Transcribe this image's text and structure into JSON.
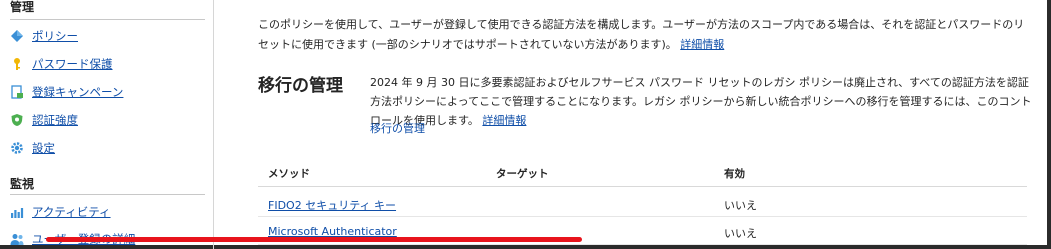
{
  "sidebar": {
    "manage_heading": "管理",
    "manage_items": [
      {
        "label": "ポリシー",
        "icon": "diamond-icon"
      },
      {
        "label": "パスワード保護",
        "icon": "key-icon"
      },
      {
        "label": "登録キャンペーン",
        "icon": "document-icon"
      },
      {
        "label": "認証強度",
        "icon": "shield-icon"
      },
      {
        "label": "設定",
        "icon": "gear-icon"
      }
    ],
    "monitor_heading": "監視",
    "monitor_items": [
      {
        "label": "アクティビティ",
        "icon": "bar-chart-icon"
      },
      {
        "label": "ユーザー登録の詳細",
        "icon": "people-icon"
      }
    ]
  },
  "main": {
    "intro_text": "このポリシーを使用して、ユーザーが登録して使用できる認証方法を構成します。ユーザーが方法のスコープ内である場合は、それを認証とパスワードのリセットに使用できます (一部のシナリオではサポートされていない方法があります)。",
    "intro_link": "詳細情報",
    "migration_title": "移行の管理",
    "migration_text": "2024 年 9 月 30 日に多要素認証およびセルフサービス パスワード リセットのレガシ ポリシーは廃止され、すべての認証方法を認証方法ポリシーによってここで管理することになります。レガシ ポリシーから新しい統合ポリシーへの移行を管理するには、このコントロールを使用します。",
    "migration_detail_link": "詳細情報",
    "migration_manage_link": "移行の管理",
    "table": {
      "headers": [
        "メソッド",
        "ターゲット",
        "有効"
      ],
      "rows": [
        {
          "method": "FIDO2 セキュリティ キー",
          "target": "",
          "enabled": "いいえ"
        },
        {
          "method": "Microsoft Authenticator",
          "target": "",
          "enabled": "いいえ"
        }
      ]
    },
    "highlight_color": "#e8141c",
    "link_color": "#0f4ea8"
  }
}
